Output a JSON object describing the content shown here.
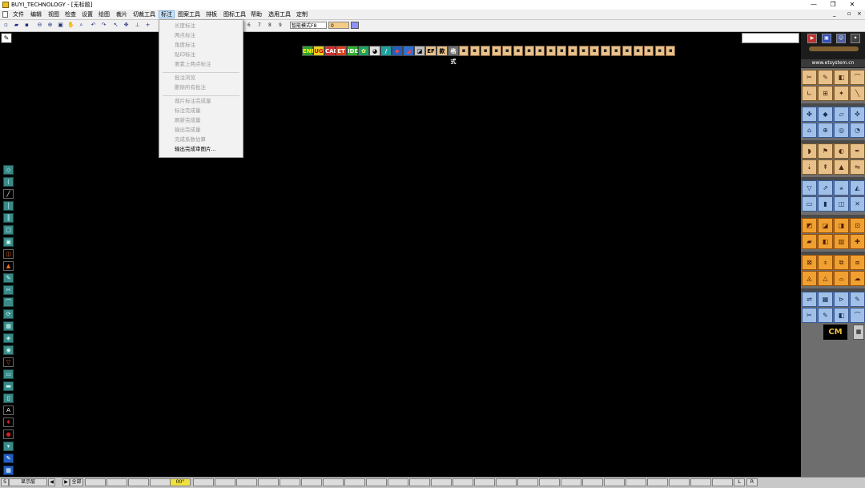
{
  "window": {
    "title": "BUYI_TECHNOLOGY - [无标题]",
    "controls": {
      "minimize": "—",
      "maximize": "❐",
      "close": "✕"
    }
  },
  "menubar": {
    "items": [
      "文件",
      "编辑",
      "视图",
      "检查",
      "设置",
      "绘图",
      "裁片",
      "切裁工具",
      "标注",
      "图案工具",
      "排板",
      "图标工具",
      "帮助",
      "选用工具",
      "定制"
    ],
    "active": "标注",
    "mdi_controls": {
      "minimize": "_",
      "restore": "▫",
      "close": "×"
    }
  },
  "toolbar": {
    "numbers": [
      "6",
      "7",
      "8",
      "9"
    ],
    "mode_select": "智能模式F8",
    "value_field": "0"
  },
  "dropdown_menu": {
    "items": [
      {
        "label": "长度标注",
        "enabled": false
      },
      {
        "label": "两点标注",
        "enabled": false
      },
      {
        "label": "角度标注",
        "enabled": false
      },
      {
        "label": "贴印标注",
        "enabled": false
      },
      {
        "label": "要素上两点标注",
        "enabled": false
      },
      {
        "label": "批注浏览",
        "enabled": false
      },
      {
        "label": "删除所有批注",
        "enabled": false
      },
      {
        "label": "裁片标注完成量",
        "enabled": false
      },
      {
        "label": "标注完成量",
        "enabled": false
      },
      {
        "label": "刷新完成量",
        "enabled": false
      },
      {
        "label": "输出完成量",
        "enabled": false
      },
      {
        "label": "完成系数估算",
        "enabled": false
      },
      {
        "label": "输出完成审图片...",
        "enabled": true
      }
    ]
  },
  "logo_strip": {
    "labels": [
      "ENF",
      "UG",
      "CAD",
      "ET",
      "IDEF",
      "✿",
      "◕",
      "/",
      "◆",
      "◢",
      "◪",
      "EF",
      "款",
      "格式"
    ],
    "cell_count": 20
  },
  "left_toolbar": {
    "icons": [
      "◇",
      "⟨",
      "╱",
      "│",
      "║",
      "□",
      "▣",
      "◫",
      "▲",
      "✎",
      "✂",
      "⌒",
      "⟳",
      "▦",
      "◈",
      "◉",
      "▽",
      "▭",
      "▬",
      "▯",
      "A",
      "♦",
      "●",
      "▾",
      "✎",
      "▦"
    ]
  },
  "right_panel": {
    "website": "www.etsystem.cn",
    "logo_text": "CM",
    "calc_icon": "▦"
  },
  "statusbar": {
    "first": "S",
    "layer_label": "显示层",
    "nav_prev": "◀",
    "nav_next": "▶",
    "all_label": "全部",
    "highlight": "00°",
    "right_labels": [
      "L",
      "R"
    ]
  },
  "colors": {
    "canvas": "#000000",
    "menu_active": "#cce4f7",
    "right_panel_btn": "#e8c08a",
    "left_toolbar": "#3a8a8a"
  }
}
